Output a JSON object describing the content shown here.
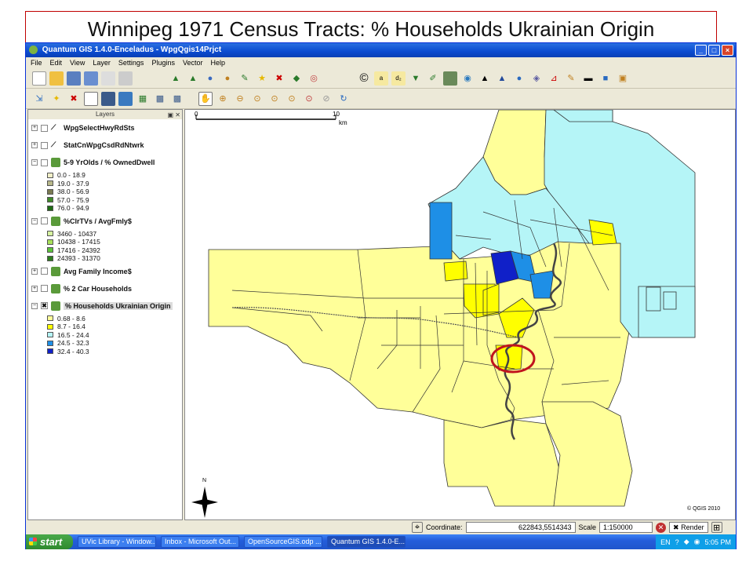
{
  "slide": {
    "title": "Winnipeg 1971 Census Tracts: % Households Ukrainian Origin"
  },
  "window": {
    "title": "Quantum GIS 1.4.0-Enceladus - WpgQgis14Prjct"
  },
  "menu": [
    "File",
    "Edit",
    "View",
    "Layer",
    "Settings",
    "Plugins",
    "Vector",
    "Help"
  ],
  "layers_panel": {
    "title": "Layers",
    "layers": [
      {
        "name": "WpgSelectHwyRdSts",
        "checked": false,
        "expanded": false,
        "legend": []
      },
      {
        "name": "StatCnWpgCsdRdNtwrk",
        "checked": false,
        "expanded": false,
        "legend": []
      },
      {
        "name": "5-9 YrOlds / % OwnedDwell",
        "checked": false,
        "expanded": true,
        "legend": [
          {
            "label": "0.0 - 18.9",
            "color": "#f2f0c8"
          },
          {
            "label": "19.0 - 37.9",
            "color": "#b8b88a"
          },
          {
            "label": "38.0 - 56.9",
            "color": "#7a7a52"
          },
          {
            "label": "57.0 - 75.9",
            "color": "#3f8a2a"
          },
          {
            "label": "76.0 - 94.9",
            "color": "#1f6b14"
          }
        ]
      },
      {
        "name": "%ClrTVs / AvgFmly$",
        "checked": false,
        "expanded": true,
        "legend": [
          {
            "label": "3460 - 10437",
            "color": "#d6f2a0"
          },
          {
            "label": "10438 - 17415",
            "color": "#a8e05a"
          },
          {
            "label": "17416 - 24392",
            "color": "#5cc23a"
          },
          {
            "label": "24393 - 31370",
            "color": "#2e7d1e"
          }
        ]
      },
      {
        "name": "Avg Family Income$",
        "checked": false,
        "expanded": false,
        "legend": []
      },
      {
        "name": "% 2 Car Households",
        "checked": false,
        "expanded": false,
        "legend": []
      },
      {
        "name": "% Households Ukrainian Origin",
        "checked": true,
        "expanded": true,
        "selected": true,
        "legend": [
          {
            "label": "0.68 - 8.6",
            "color": "#ffff9a"
          },
          {
            "label": "8.7 - 16.4",
            "color": "#ffff00"
          },
          {
            "label": "16.5 - 24.4",
            "color": "#b5f5f7"
          },
          {
            "label": "24.5 - 32.3",
            "color": "#1e8fe6"
          },
          {
            "label": "32.4 - 40.3",
            "color": "#1020c8"
          }
        ]
      }
    ]
  },
  "map": {
    "scalebar": {
      "zero": "0",
      "ten": "10",
      "unit": "km"
    },
    "north_label": "N",
    "copyright": "© QGIS 2010"
  },
  "statusbar": {
    "coordinate_label": "Coordinate:",
    "coordinate_value": "622843,5514343",
    "scale_label": "Scale",
    "scale_value": "1:150000",
    "render_label": "Render"
  },
  "taskbar": {
    "start": "start",
    "tasks": [
      "UVic Library - Window...",
      "Inbox - Microsoft Out...",
      "OpenSourceGIS.odp ...",
      "Quantum GIS 1.4.0-E..."
    ],
    "lang": "EN",
    "time": "5:05 PM"
  }
}
